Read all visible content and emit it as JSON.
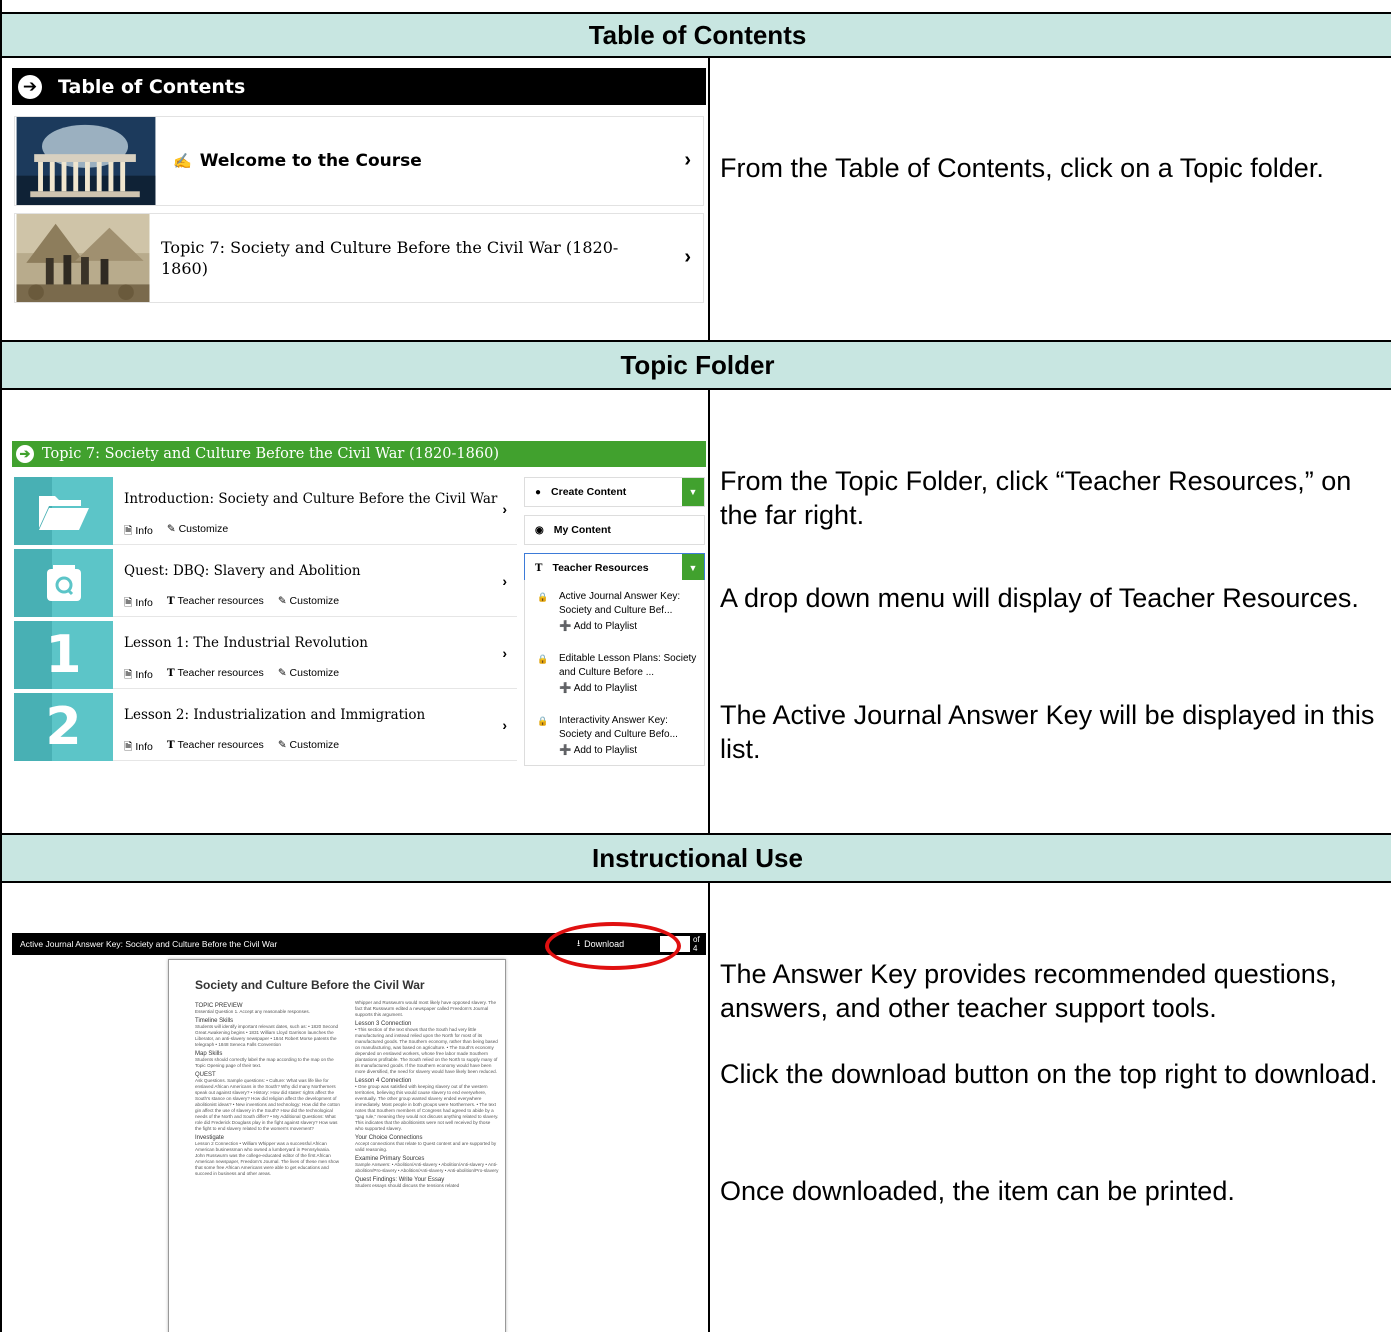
{
  "sections": {
    "toc": {
      "header": "Table of Contents",
      "bar_title": "Table of Contents",
      "items": [
        {
          "label": "Welcome to the Course"
        },
        {
          "label": "Topic 7: Society and Culture Before the Civil War (1820-1860)"
        }
      ],
      "instruction": "From the Table of Contents, click on a Topic folder."
    },
    "topic": {
      "header": "Topic Folder",
      "bar_title": "Topic 7: Society and Culture Before the Civil War (1820-1860)",
      "lessons": [
        {
          "tile": "",
          "title": "Introduction: Society and Culture Before the Civil War",
          "links": [
            "Info",
            "Customize"
          ]
        },
        {
          "tile": "",
          "title": "Quest: DBQ: Slavery and Abolition",
          "links": [
            "Info",
            "Teacher resources",
            "Customize"
          ]
        },
        {
          "tile": "1",
          "title": "Lesson 1: The Industrial Revolution",
          "links": [
            "Info",
            "Teacher resources",
            "Customize"
          ]
        },
        {
          "tile": "2",
          "title": "Lesson 2: Industrialization and Immigration",
          "links": [
            "Info",
            "Teacher resources",
            "Customize"
          ]
        }
      ],
      "side": {
        "create": "Create Content",
        "my_content": "My Content",
        "teacher_resources": "Teacher Resources",
        "resources": [
          {
            "title": "Active Journal Answer Key: Society and Culture Bef...",
            "add": "Add to Playlist"
          },
          {
            "title": "Editable Lesson Plans: Society and Culture Before ...",
            "add": "Add to Playlist"
          },
          {
            "title": "Interactivity Answer Key: Society and Culture Befo...",
            "add": "Add to Playlist"
          }
        ]
      },
      "instructions": [
        "From the Topic Folder, click “Teacher Resources,” on the far right.",
        "A drop down menu will display of Teacher Resources.",
        "The Active Journal Answer Key will be displayed in this list."
      ]
    },
    "instructional": {
      "header": "Instructional Use",
      "doc_bar_title": "Active Journal Answer Key: Society and Culture Before the Civil War",
      "download_label": "Download",
      "page_of": "of 4",
      "doc_title": "Society and Culture Before the Civil War",
      "doc_left": [
        {
          "h": "TOPIC PREVIEW",
          "t": "Essential Question\n1. Accept any reasonable responses."
        },
        {
          "h": "Timeline Skills",
          "t": "Students will identify important relevant dates, such as: • 1820 Second Great Awakening begins • 1831 William Lloyd Garrison launches the Liberator, an anti-slavery newspaper • 1844 Robert Morse patents the telegraph • 1848 Seneca Falls Convention"
        },
        {
          "h": "Map Skills",
          "t": "Students should correctly label the map according to the map on the Topic Opening page of their text."
        },
        {
          "h": "QUEST",
          "t": "Ask Questions. Sample questions: • Culture: What was life like for enslaved African Americans in the South? Why did many Northerners speak out against slavery? • History: How did states' rights affect the South's stance on slavery? How did religion affect the development of abolitionist ideas? • New inventions and technology: How did the cotton gin affect the use of slavery in the South? How did the technological needs of the North and South differ? • My Additional Questions: What role did Frederick Douglass play in the fight against slavery? How was the fight to end slavery related to the women's movement?"
        },
        {
          "h": "Investigate",
          "t": "Lesson 2 Connection • William Whipper was a successful African American businessman who owned a lumberyard in Pennsylvania. John Russwurm was the college-educated editor of the first African American newspaper, Freedom's Journal. The lives of these men show that some free African Americans were able to get educations and succeed in business and other areas."
        }
      ],
      "doc_right": [
        {
          "h": "",
          "t": "Whipper and Russwurm would most likely have opposed slavery. The fact that Russwurm edited a newspaper called Freedom's Journal supports this argument."
        },
        {
          "h": "Lesson 3 Connection",
          "t": "• This section of the text shows that the South had very little manufacturing and instead relied upon the North for most of its manufactured goods. The Southern economy, rather than being based on manufacturing, was based on agriculture. • The South's economy depended on enslaved workers, whose free labor made Southern plantations profitable. The South relied on the North to supply many of its manufactured goods. If the Southern economy would have been more diversified, the need for slavery would have likely been reduced."
        },
        {
          "h": "Lesson 4 Connection",
          "t": "• One group was satisfied with keeping slavery out of the western territories, believing this would cause slavery to end everywhere, eventually. The other group wanted slavery ended everywhere immediately. Most people in both groups were Northerners. • The text notes that Southern members of Congress had agreed to abide by a \"gag rule,\" meaning they would not discuss anything related to slavery. This indicates that the abolitionists were not well received by those who supported slavery."
        },
        {
          "h": "Your Choice Connections",
          "t": "Accept connections that relate to Quest content and are supported by valid reasoning."
        },
        {
          "h": "Examine Primary Sources",
          "t": "Sample Answers: • Abolition/Anti-slavery • Abolition/Anti-slavery • Anti-abolition/Pro-slavery • Abolition/Anti-slavery • Anti-abolition/Pro-slavery"
        },
        {
          "h": "Quest Findings: Write Your Essay",
          "t": "Student essays should discuss the tensions related"
        }
      ],
      "instructions": [
        "The Answer Key provides recommended questions, answers, and other teacher support tools.",
        "Click the download button on the top right to download.",
        "Once downloaded, the item can be printed."
      ]
    }
  },
  "colors": {
    "header_bg": "#c8e6e1",
    "green": "#41a12e",
    "teal": "#5cc5c8",
    "highlight": "#e01010"
  }
}
